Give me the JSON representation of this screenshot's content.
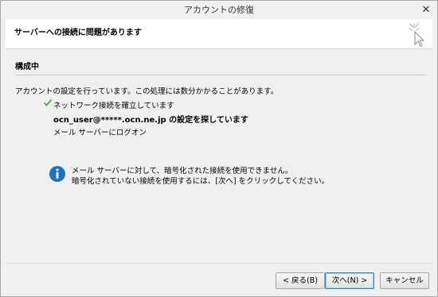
{
  "window": {
    "title": "アカウントの修復",
    "close_glyph": "✕"
  },
  "header": {
    "heading": "サーバーへの接続に問題があります",
    "icon": "wizard-cursor-icon"
  },
  "main": {
    "section_title": "構成中",
    "intro": "アカウントの設定を行っています。この処理には数分かかることがあります。",
    "steps": [
      {
        "label": "ネットワーク接続を確立しています",
        "status": "done"
      },
      {
        "label": "ocn_user@*****.ocn.ne.jp の設定を探しています",
        "status": "active"
      },
      {
        "label": "メール サーバーにログオン",
        "status": "pending"
      }
    ],
    "info": {
      "icon": "info-icon",
      "line1": "メール サーバーに対して、暗号化された接続を使用できません。",
      "line2": "暗号化されていない接続を使用するには、[次へ] をクリックしてください。"
    }
  },
  "footer": {
    "back_label": "< 戻る(B)",
    "next_label": "次へ(N) >",
    "cancel_label": "キャンセル"
  },
  "colors": {
    "check": "#4aa34a",
    "info": "#1e73be"
  }
}
